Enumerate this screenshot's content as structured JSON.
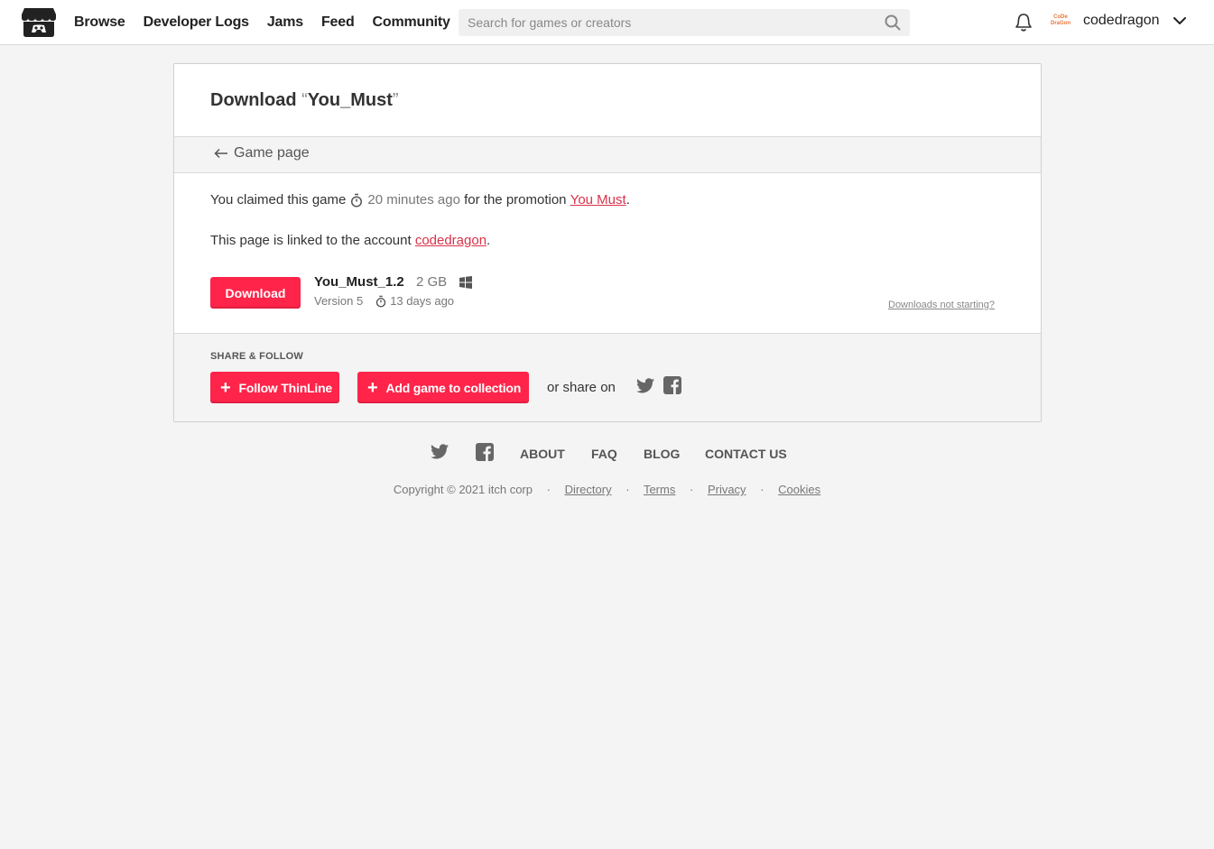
{
  "header": {
    "nav": [
      "Browse",
      "Developer Logs",
      "Jams",
      "Feed",
      "Community"
    ],
    "search_placeholder": "Search for games or creators",
    "avatar_text": "CoDe DraGon",
    "username": "codedragon"
  },
  "card": {
    "title_prefix": "Download",
    "title_open_quote": "“",
    "title_game": "You_Must",
    "title_close_quote": "”",
    "back_label": "Game page",
    "claim_prefix": "You claimed this game",
    "claim_time": "20 minutes ago",
    "claim_middle": "for the promotion",
    "promotion_name": "You Must",
    "claim_suffix": ".",
    "linked_prefix": "This page is linked to the account",
    "linked_account": "codedragon",
    "linked_suffix": ".",
    "download_label": "Download",
    "file_name": "You_Must_1.2",
    "file_size": "2 GB",
    "file_version": "Version 5",
    "file_age": "13 days ago",
    "not_starting": "Downloads not starting?"
  },
  "share": {
    "label": "SHARE & FOLLOW",
    "follow_label": "Follow ThinLine",
    "collection_label": "Add game to collection",
    "share_on": "or share on"
  },
  "footer": {
    "links": [
      "ABOUT",
      "FAQ",
      "BLOG",
      "CONTACT US"
    ],
    "copyright": "Copyright © 2021 itch corp",
    "sub_links": [
      "Directory",
      "Terms",
      "Privacy",
      "Cookies"
    ],
    "separator": "·"
  },
  "colors": {
    "accent": "#ff2449",
    "link_red": "#d9334a",
    "background": "#f4f4f4"
  }
}
